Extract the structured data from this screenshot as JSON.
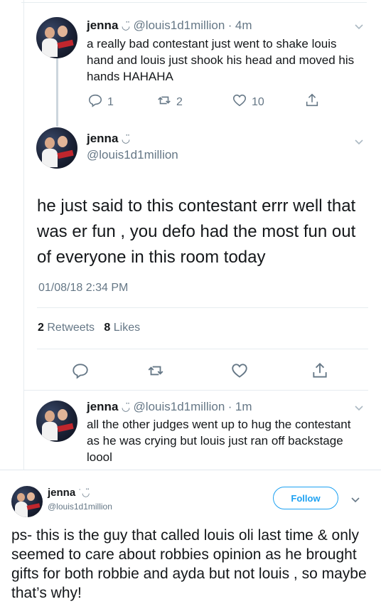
{
  "tweet1": {
    "name": "jenna",
    "name_emoji": "◡̈",
    "handle": "@louis1d1million",
    "dot": "·",
    "time": "4m",
    "text": "a really bad contestant just went to shake louis hand and louis just shook his head and moved his hands HAHAHA",
    "replies": "1",
    "retweets": "2",
    "likes": "10"
  },
  "tweet2": {
    "name": "jenna",
    "name_emoji": "◡̈",
    "handle": "@louis1d1million",
    "text": "he just said to this contestant errr well that was er fun , you defo had the most fun out of everyone in this room today",
    "timestamp": "01/08/18 2:34 PM",
    "retweets_count": "2",
    "retweets_label": "Retweets",
    "likes_count": "8",
    "likes_label": "Likes"
  },
  "tweet3": {
    "name": "jenna",
    "name_emoji": "◡̈",
    "handle": "@louis1d1million",
    "dot": "·",
    "time": "1m",
    "text": "all the other judges went up to hug the contestant as he was crying but louis just ran off backstage loool"
  },
  "tweet4": {
    "name": "jenna",
    "name_emoji": "˙◡̈",
    "handle": "@louis1d1million",
    "follow_label": "Follow",
    "text": "ps- this is the guy that called louis oli last time & only seemed to care about robbies opinion as he brought gifts for both robbie and ayda but not louis , so maybe that’s why!"
  },
  "colors": {
    "accent": "#1da1f2",
    "muted": "#657786",
    "text": "#14171a",
    "divider": "#e6ecf0"
  },
  "icons": [
    "reply-icon",
    "retweet-icon",
    "like-icon",
    "share-icon",
    "chevron-down-icon"
  ]
}
